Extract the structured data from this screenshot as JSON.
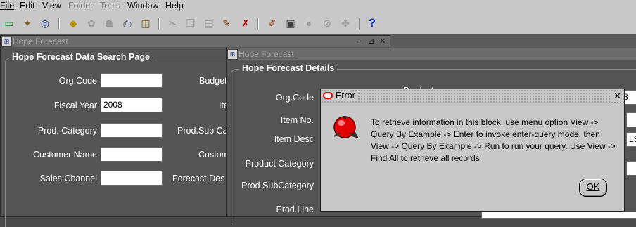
{
  "menu": {
    "items": [
      {
        "label": "File",
        "disabled": false
      },
      {
        "label": "Edit",
        "disabled": false
      },
      {
        "label": "View",
        "disabled": false
      },
      {
        "label": "Folder",
        "disabled": true
      },
      {
        "label": "Tools",
        "disabled": true
      },
      {
        "label": "Window",
        "disabled": false
      },
      {
        "label": "Help",
        "disabled": false
      }
    ]
  },
  "toolbar": {
    "icons": [
      "new-icon",
      "flashlight-icon",
      "navigator-icon",
      "save-icon",
      "next-step-icon",
      "switch-responsibility-icon",
      "print-icon",
      "close-form-icon",
      "cut-icon",
      "copy-icon",
      "paste-icon",
      "clear-record-icon",
      "delete-record-icon",
      "edit-field-icon",
      "zoom-icon",
      "translations-icon",
      "attachments-icon",
      "folder-tools-icon",
      "help-icon"
    ],
    "help_glyph": "?"
  },
  "search_window": {
    "title": "Hope Forecast",
    "section_title": "Hope Forecast Data Search Page",
    "labels": {
      "org_code": "Org.Code",
      "fiscal_year": "Fiscal Year",
      "prod_category": "Prod. Category",
      "customer_name": "Customer Name",
      "sales_channel": "Sales Channel",
      "budget": "Budget",
      "item": "Item",
      "prod_sub_category": "Prod.Sub Cat",
      "customer": "Custom",
      "forecast_desc": "Forecast Des"
    },
    "values": {
      "org_code": "",
      "fiscal_year": "2008",
      "prod_category": "",
      "customer_name": "",
      "sales_channel": ""
    }
  },
  "details_window": {
    "title": "Hope Forecast",
    "section_title": "Hope Forecast Details",
    "labels": {
      "org_code": "Org.Code",
      "item_no": "Item No.",
      "item_desc": "Item Desc",
      "product_category": "Product Category",
      "prod_subcategory": "Prod.SubCategory",
      "prod_line": "Prod.Line",
      "product_partial": "Product"
    },
    "partial_values": {
      "value_8": "8",
      "value_ls": "LS"
    }
  },
  "error_dialog": {
    "title": "Error",
    "close_glyph": "✕",
    "message": "To retrieve information in this block, use menu option View -> Query By Example -> Enter to invoke enter-query mode, then View -> Query By Example -> Run to run your query. Use View -> Find All to retrieve all records.",
    "ok_label": "OK"
  },
  "window_controls": {
    "minimize": "⌐",
    "maximize": "⊿",
    "close": "✕"
  },
  "colors": {
    "desktop": "#5a5a5a",
    "chrome": "#c8c8c8",
    "panel": "#545454",
    "alarm_red": "#e00000"
  }
}
